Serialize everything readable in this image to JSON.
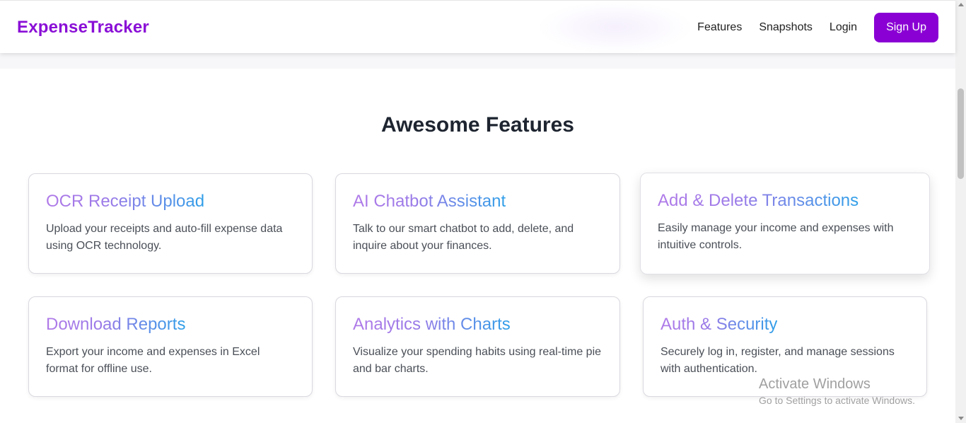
{
  "nav": {
    "brand": "ExpenseTracker",
    "links": [
      "Features",
      "Snapshots",
      "Login"
    ],
    "signup_label": "Sign Up"
  },
  "section": {
    "title": "Awesome Features"
  },
  "features": [
    {
      "title": "OCR Receipt Upload",
      "description": "Upload your receipts and auto-fill expense data using OCR technology."
    },
    {
      "title": "AI Chatbot Assistant",
      "description": "Talk to our smart chatbot to add, delete, and inquire about your finances."
    },
    {
      "title": "Add & Delete Transactions",
      "description": "Easily manage your income and expenses with intuitive controls."
    },
    {
      "title": "Download Reports",
      "description": "Export your income and expenses in Excel format for offline use."
    },
    {
      "title": "Analytics with Charts",
      "description": "Visualize your spending habits using real-time pie and bar charts."
    },
    {
      "title": "Auth & Security",
      "description": "Securely log in, register, and manage sessions with authentication."
    }
  ],
  "watermark": {
    "title": "Activate Windows",
    "subtitle": "Go to Settings to activate Windows."
  },
  "colors": {
    "brand": "#8a0fd6",
    "button": "#8a00d4",
    "title_gradient_start": "#b07ae8",
    "title_gradient_end": "#2f9fe8"
  }
}
